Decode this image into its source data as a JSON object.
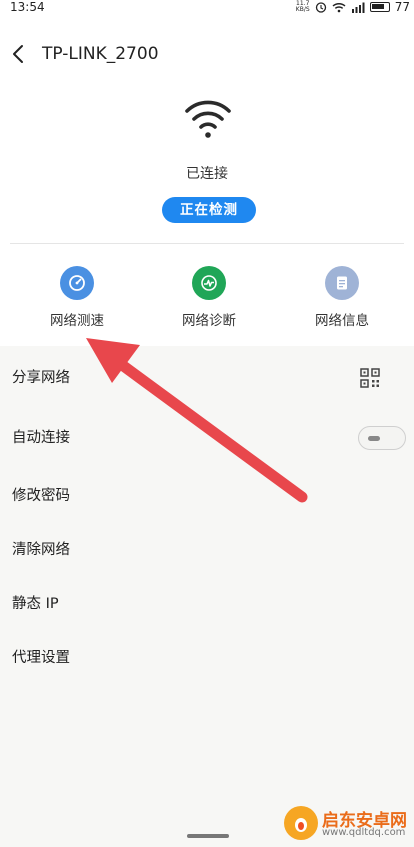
{
  "status_bar": {
    "time": "13:54",
    "net_speed_value": "11.7",
    "net_speed_unit": "KB/S",
    "battery": "77"
  },
  "header": {
    "title": "TP-LINK_2700"
  },
  "connection": {
    "status": "已连接",
    "detect_button": "正在检测"
  },
  "tools": [
    {
      "label": "网络测速",
      "color": "#4a90e2"
    },
    {
      "label": "网络诊断",
      "color": "#20a657"
    },
    {
      "label": "网络信息",
      "color": "#9fb3d6"
    }
  ],
  "settings": [
    {
      "label": "分享网络"
    },
    {
      "label": "自动连接"
    },
    {
      "label": "修改密码"
    },
    {
      "label": "清除网络"
    },
    {
      "label": "静态 IP"
    },
    {
      "label": "代理设置"
    }
  ],
  "watermark": {
    "title": "启东安卓网",
    "url": "www.qdltdq.com"
  },
  "colors": {
    "accent": "#1f88f0",
    "arrow": "#e8474c"
  }
}
